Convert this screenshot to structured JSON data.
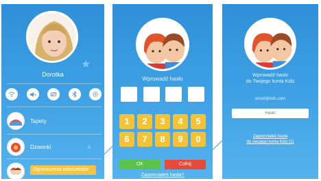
{
  "screen1": {
    "profile_name": "Dorotka",
    "icons": [
      "wifi-icon",
      "volume-mute-icon",
      "eye-off-icon",
      "bluetooth-icon",
      "settings-icon"
    ],
    "menu": [
      {
        "label": "Tapety",
        "icon": "wallpaper-icon"
      },
      {
        "label": "Dzwonki",
        "icon": "ringtone-icon"
      }
    ],
    "bottom_item": "Ograniczenia rodzicielskie"
  },
  "screen2": {
    "title": "Wprowadź hasło",
    "keys": [
      "1",
      "2",
      "3",
      "4",
      "5",
      "6",
      "7",
      "8",
      "9",
      "0"
    ],
    "ok_label": "OK",
    "cancel_label": "Cofnij",
    "forgot_link": "Zapomniałeś hasła?"
  },
  "screen3": {
    "title_line1": "Wprowadź hasło",
    "title_line2": "do Twojego konta Kids",
    "email_text": "email@kids.com",
    "password_placeholder": "Hasło",
    "forgot_line1": "Zapomniałeś hasła",
    "forgot_line2": "do swojego konta Kids (2)"
  },
  "colors": {
    "background": "#3c9fe3",
    "key_yellow": "#f4c237",
    "ok_green": "#5bc34a",
    "cancel_red": "#e84a3a"
  }
}
